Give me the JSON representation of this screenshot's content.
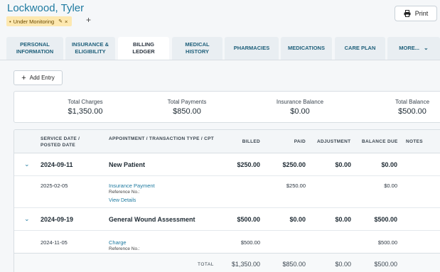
{
  "patient": {
    "name": "Lockwood, Tyler",
    "status_badge": "Under Monitoring"
  },
  "toolbar": {
    "print_label": "Print"
  },
  "tabs": [
    {
      "label": "PERSONAL INFORMATION"
    },
    {
      "label": "INSURANCE & ELIGIBILITY"
    },
    {
      "label": "BILLING LEDGER"
    },
    {
      "label": "MEDICAL HISTORY"
    },
    {
      "label": "PHARMACIES"
    },
    {
      "label": "MEDICATIONS"
    },
    {
      "label": "CARE PLAN"
    },
    {
      "label": "MORE..."
    }
  ],
  "add_entry_label": "Add Entry",
  "summary": [
    {
      "label": "Total Charges",
      "value": "$1,350.00"
    },
    {
      "label": "Total Payments",
      "value": "$850.00"
    },
    {
      "label": "Insurance Balance",
      "value": "$0.00"
    },
    {
      "label": "Total Balance",
      "value": "$500.00"
    }
  ],
  "table": {
    "headers": {
      "date": "SERVICE DATE / POSTED DATE",
      "type": "APPOINTMENT / TRANSACTION TYPE / CPT",
      "billed": "BILLED",
      "paid": "PAID",
      "adjustment": "ADJUSTMENT",
      "balance": "BALANCE DUE",
      "notes": "NOTES"
    },
    "groups": [
      {
        "date": "2024-09-11",
        "title": "New Patient",
        "billed": "$250.00",
        "paid": "$250.00",
        "adjustment": "$0.00",
        "balance": "$0.00",
        "detail": {
          "date": "2025-02-05",
          "type": "Insurance Payment",
          "reference": "Reference No.:",
          "link": "View Details",
          "billed": "",
          "paid": "$250.00",
          "balance": "$0.00"
        }
      },
      {
        "date": "2024-09-19",
        "title": "General Wound Assessment",
        "billed": "$500.00",
        "paid": "$0.00",
        "adjustment": "$0.00",
        "balance": "$500.00",
        "detail": {
          "date": "2024-11-05",
          "type": "Charge",
          "reference": "Reference No.:",
          "billed": "$500.00",
          "paid": "",
          "balance": "$500.00"
        }
      }
    ],
    "total": {
      "label": "TOTAL",
      "billed": "$1,350.00",
      "paid": "$850.00",
      "adjustment": "$0.00",
      "balance": "$500.00"
    }
  }
}
